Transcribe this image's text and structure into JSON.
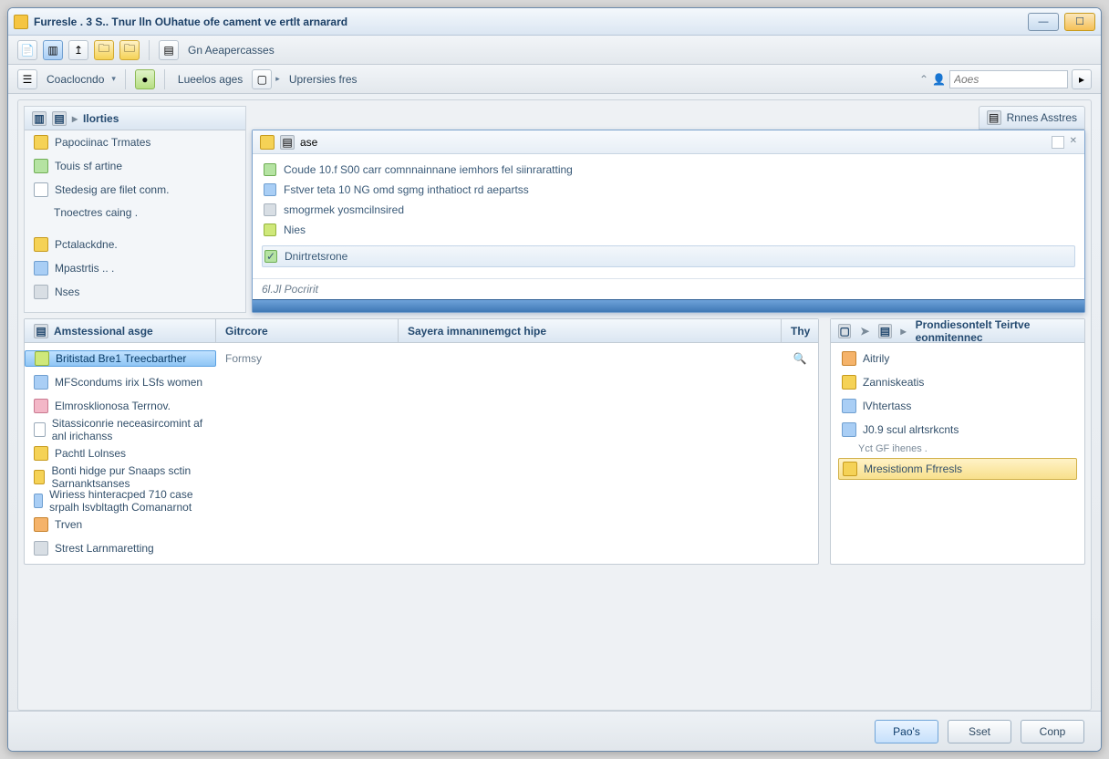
{
  "window": {
    "title": "Furresle . 3 S.. Tnur lln OUhatue ofe cament ve ertlt arnarard"
  },
  "toolbar1": {
    "label": "Gn Aeapercasses"
  },
  "toolbar2": {
    "item1": "Coaclocndo",
    "item2": "Lueelos ages",
    "item3": "Uprersies fres",
    "search_placeholder": "Aoes"
  },
  "sidebar": {
    "tab": "Ilorties",
    "items": [
      "Papociinac Trmates",
      "Touis sf artine",
      "Stedesig are filet conm.",
      "Tnoectres caing .",
      "Pctalackdne.",
      "Mpastrtis .. .",
      "Nses"
    ]
  },
  "right_tab": "Rnnes Asstres",
  "msg": {
    "head": "ase",
    "rows": [
      "Coude 10.f S00 carr comnnainnane iemhors fel siinraratting",
      "Fstver teta 10 NG omd sgmg inthatioct rd aepartss",
      "smogrmek yosmcilnsired",
      "Nies"
    ],
    "selected": "Dnirtretsrone",
    "status": "6l.Jl Pocririt"
  },
  "list": {
    "columns": [
      "Amstessional asge",
      "Gitrcore",
      "Sayera imnanınemgct hipe",
      "Thy"
    ],
    "rows": [
      {
        "c1": "Britistad Bre1 Treecbarther",
        "c2": "Formsy",
        "c3": "",
        "sel": true,
        "magnify": true,
        "icon": "lime"
      },
      {
        "c1": "MFScondums irix LSfs women",
        "c2": "",
        "c3": "",
        "icon": "blue"
      },
      {
        "c1": "Elmrosklionosa Terrnov.",
        "c2": "",
        "c3": "",
        "icon": "rose"
      },
      {
        "c1": "Sitassiconrie neceasircomint af anl irichanss",
        "c2": "",
        "c3": "",
        "icon": "note"
      },
      {
        "c1": "Pachtl Lolnses",
        "c2": "",
        "c3": "",
        "icon": "folder"
      },
      {
        "c1": "Bonti hidge pur Snaaps sctin Sarnanktsаnses",
        "c2": "",
        "c3": "",
        "icon": "folder"
      },
      {
        "c1": "Wiriess hinteracped 710 case srpalh lsvbltagth Comanarnot",
        "c2": "",
        "c3": "",
        "icon": "blue"
      },
      {
        "c1": "Trven",
        "c2": "",
        "c3": "",
        "icon": "orange"
      },
      {
        "c1": "Strest Larnmaretting",
        "c2": "",
        "c3": "",
        "icon": "grey"
      }
    ]
  },
  "right": {
    "toolbar_icons": 3,
    "title": "Prondiesontelt Teirtve eonmitennec",
    "items": [
      {
        "label": "Aitrily",
        "icon": "orange"
      },
      {
        "label": "Zanniskeatis",
        "icon": "folder"
      },
      {
        "label": "lVhtertass",
        "icon": "blue"
      },
      {
        "label": "J0.9 scul alrtsrkcnts",
        "icon": "blue"
      }
    ],
    "sub": "Yct GF ihenes .",
    "highlight": "Mresistionm Ffrresls"
  },
  "footer": {
    "primary": "Pao's",
    "mid": "Sset",
    "last": "Conp"
  }
}
